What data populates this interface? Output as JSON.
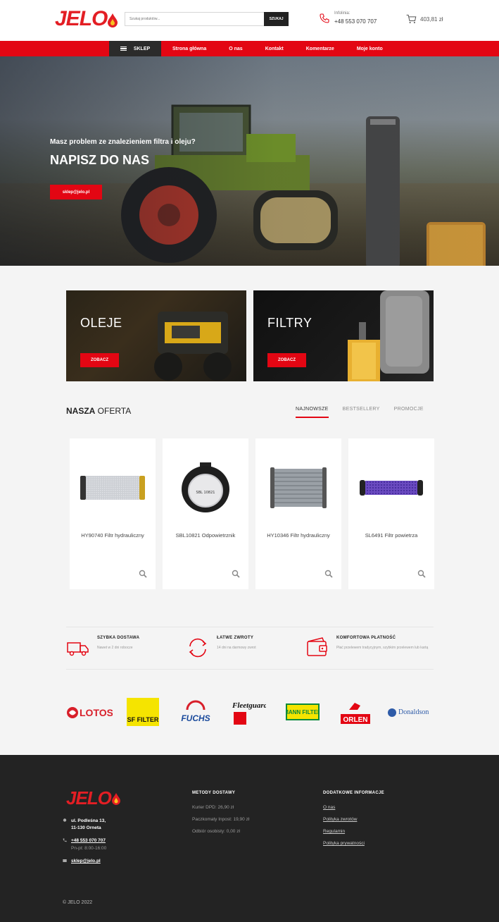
{
  "header": {
    "logo": "JELO",
    "search_placeholder": "Szukaj produktów...",
    "search_button": "SZUKAJ",
    "phone_label": "Infolinia:",
    "phone_number": "+48 553 070 707",
    "cart_amount": "403,81 zł"
  },
  "nav": {
    "shop": "SKLEP",
    "links": [
      "Strona główna",
      "O nas",
      "Kontakt",
      "Komentarze",
      "Moje konto"
    ]
  },
  "hero": {
    "subtitle": "Masz problem ze znalezieniem filtra i oleju?",
    "title": "NAPISZ DO NAS",
    "button": "sklep@jelo.pl"
  },
  "categories": [
    {
      "title": "OLEJE",
      "button": "ZOBACZ"
    },
    {
      "title": "FILTRY",
      "button": "ZOBACZ"
    }
  ],
  "offer": {
    "title_bold": "NASZA",
    "title_rest": " OFERTA",
    "tabs": [
      "NAJNOWSZE",
      "BESTSELLERY",
      "PROMOCJE"
    ],
    "active_tab": "NAJNOWSZE",
    "products": [
      {
        "name": "HY90740 Filtr hydrauliczny"
      },
      {
        "name": "SBL10821 Odpowietrznik",
        "print": "SBL 10821"
      },
      {
        "name": "HY10346 Filtr hydrauliczny"
      },
      {
        "name": "SL6491 Filtr powietrza"
      }
    ]
  },
  "features": [
    {
      "title": "SZYBKA DOSTAWA",
      "desc": "Nawet w 2 dni robocze",
      "icon": "truck-icon"
    },
    {
      "title": "ŁATWE ZWROTY",
      "desc": "14 dni na darmowy zwrot",
      "icon": "refresh-icon"
    },
    {
      "title": "KOMFORTOWA PŁATNOŚĆ",
      "desc": "Płać przelewem tradycyjnym, szybkim przelewem lub kartą",
      "icon": "wallet-icon"
    }
  ],
  "brands": [
    "LOTOS",
    "SF FILTER",
    "FUCHS",
    "Fleetguard",
    "MANN FILTER",
    "ORLEN",
    "Donaldson"
  ],
  "footer": {
    "logo": "JELO",
    "address_line1": "ul. Podleśna 13,",
    "address_line2": "11-130 Orneta",
    "phone": "+48 553 070 707",
    "hours": "Pn-pt: 8:00-16:00",
    "email": "sklep@jelo.pl",
    "delivery_title": "METODY DOSTAWY",
    "delivery": [
      "Kurier DPD: 26,90 zł",
      "Paczkomaty Inpost: 19,90 zł",
      "Odbiór osobisty: 0,00 zł"
    ],
    "info_title": "DODATKOWE INFORMACJE",
    "info_links": [
      "O nas",
      "Polityka zwrotów",
      "Regulamin",
      "Polityka prywatności"
    ],
    "copyright": "© JELO 2022"
  },
  "colors": {
    "accent": "#e30613",
    "dark": "#232323",
    "nav_dark": "#2b2b2b"
  }
}
